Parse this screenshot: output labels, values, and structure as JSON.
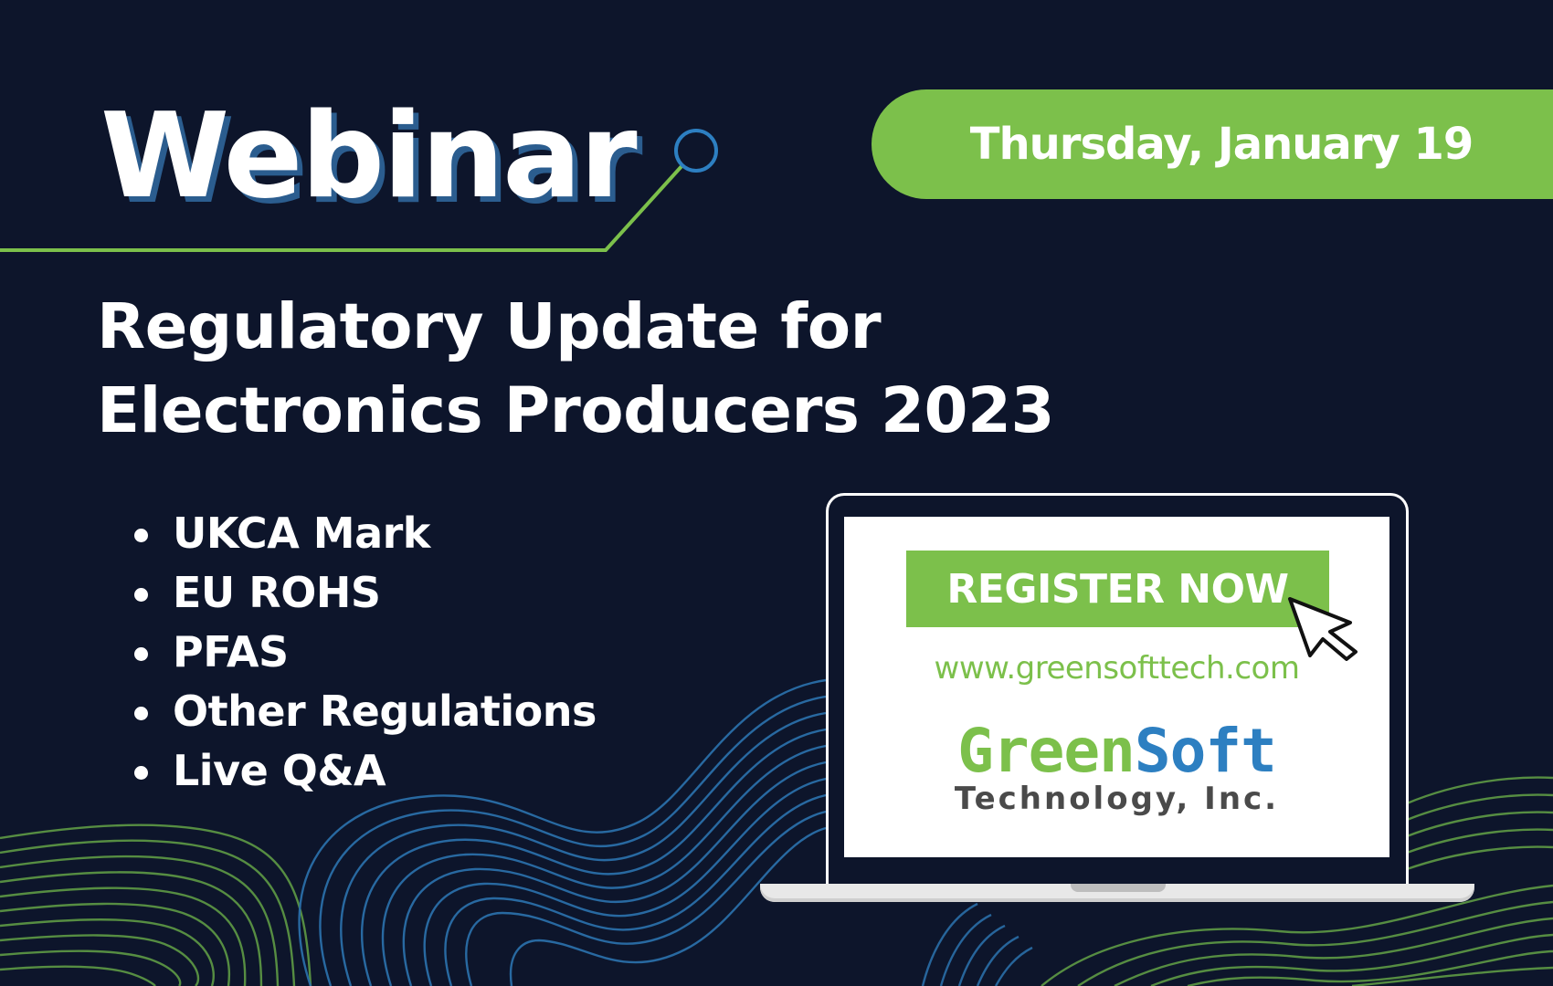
{
  "header": {
    "title": "Webinar",
    "date": "Thursday, January 19"
  },
  "headline": {
    "line1": "Regulatory Update for",
    "line2": "Electronics Producers 2023"
  },
  "topics": [
    "UKCA Mark",
    "EU ROHS",
    "PFAS",
    "Other Regulations",
    "Live Q&A"
  ],
  "laptop": {
    "button_label": "REGISTER NOW",
    "url": "www.greensofttech.com",
    "logo_green": "Green",
    "logo_blue": "Soft",
    "logo_sub": "Technology, Inc."
  },
  "colors": {
    "background": "#0d152b",
    "accent_green": "#7cc04b",
    "accent_blue": "#2d7fc1"
  },
  "icons": [
    "mouse-pointer-icon"
  ]
}
